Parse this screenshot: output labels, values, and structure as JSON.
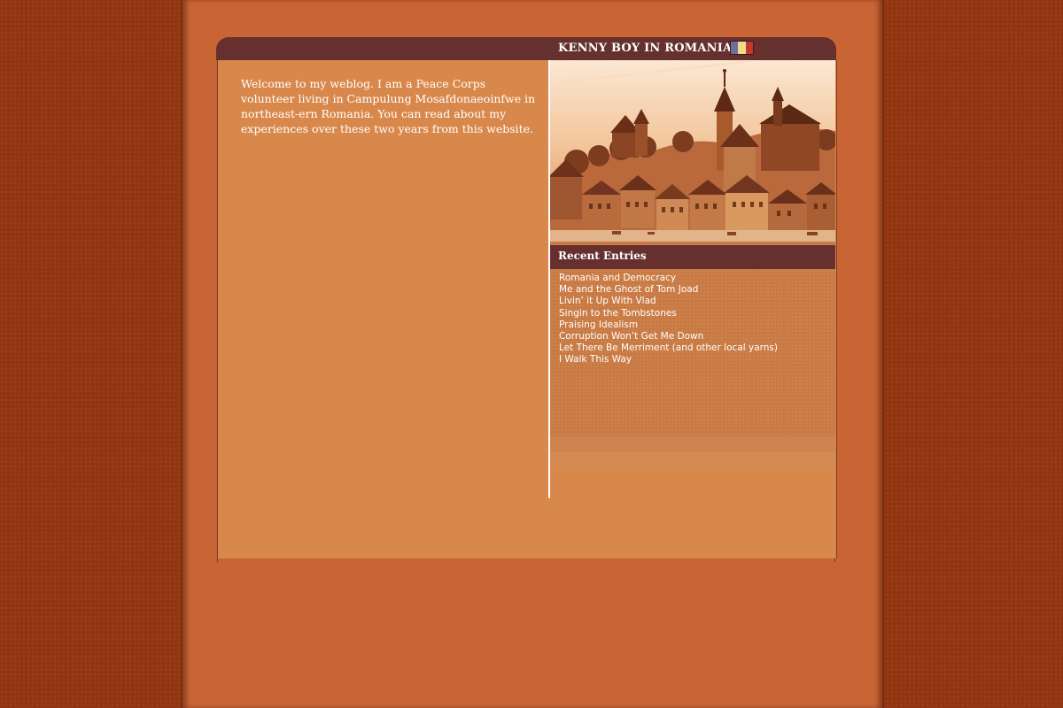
{
  "header": {
    "site_title": "KENNY BOY IN ROMANIA",
    "flag_colors": [
      "#6c6f9a",
      "#f5d98a",
      "#c0392b"
    ]
  },
  "intro": {
    "text": "Welcome to my weblog. I am a Peace Corps volunteer living in Campulung Mosafdonaeoinfwe in northeast-ern Romania. You can read about my experiences over these two years from this website."
  },
  "sidebar": {
    "photo_icon": "town-photo",
    "recent_title": "Recent Entries",
    "entries": [
      {
        "label": "Romania and Democracy"
      },
      {
        "label": "Me and the Ghost of Tom Joad"
      },
      {
        "label": "Livin’ it Up With Vlad"
      },
      {
        "label": "Singin to the Tombstones"
      },
      {
        "label": "Praising Idealism"
      },
      {
        "label": "Corruption Won’t Get Me Down"
      },
      {
        "label": "Let There Be Merriment (and other local yarns)"
      },
      {
        "label": "I Walk This Way"
      }
    ]
  },
  "colors": {
    "outer_background": "#8f3512",
    "column": "#c96535",
    "header_bar": "#66302f",
    "main_panel": "#d9884b",
    "sidebar_list": "#c77a44"
  }
}
